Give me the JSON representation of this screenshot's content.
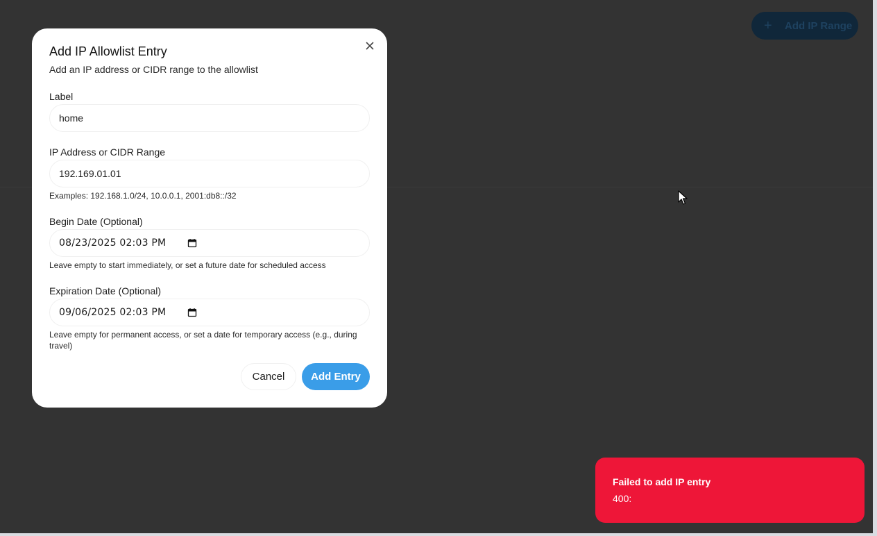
{
  "background": {
    "add_range_button": {
      "label": "Add IP Range",
      "icon": "plus-icon"
    }
  },
  "modal": {
    "title": "Add IP Allowlist Entry",
    "subtitle": "Add an IP address or CIDR range to the allowlist",
    "close_icon": "close-icon",
    "fields": {
      "label": {
        "label": "Label",
        "value": "home"
      },
      "ip": {
        "label": "IP Address or CIDR Range",
        "value": "192.169.01.01",
        "hint": "Examples: 192.168.1.0/24, 10.0.0.1, 2001:db8::/32"
      },
      "begin_date": {
        "label": "Begin Date (Optional)",
        "value": "08/23/2025 02:03 PM",
        "icon": "calendar-icon",
        "hint": "Leave empty to start immediately, or set a future date for scheduled access"
      },
      "expiration_date": {
        "label": "Expiration Date (Optional)",
        "value": "09/06/2025 02:03 PM",
        "icon": "calendar-icon",
        "hint": "Leave empty for permanent access, or set a date for temporary access (e.g., during travel)"
      }
    },
    "buttons": {
      "cancel": "Cancel",
      "submit": "Add Entry"
    }
  },
  "toast": {
    "title": "Failed to add IP entry",
    "message": "400:"
  },
  "colors": {
    "backdrop": "#333333",
    "primary": "#3a9de8",
    "error": "#ee1638"
  }
}
